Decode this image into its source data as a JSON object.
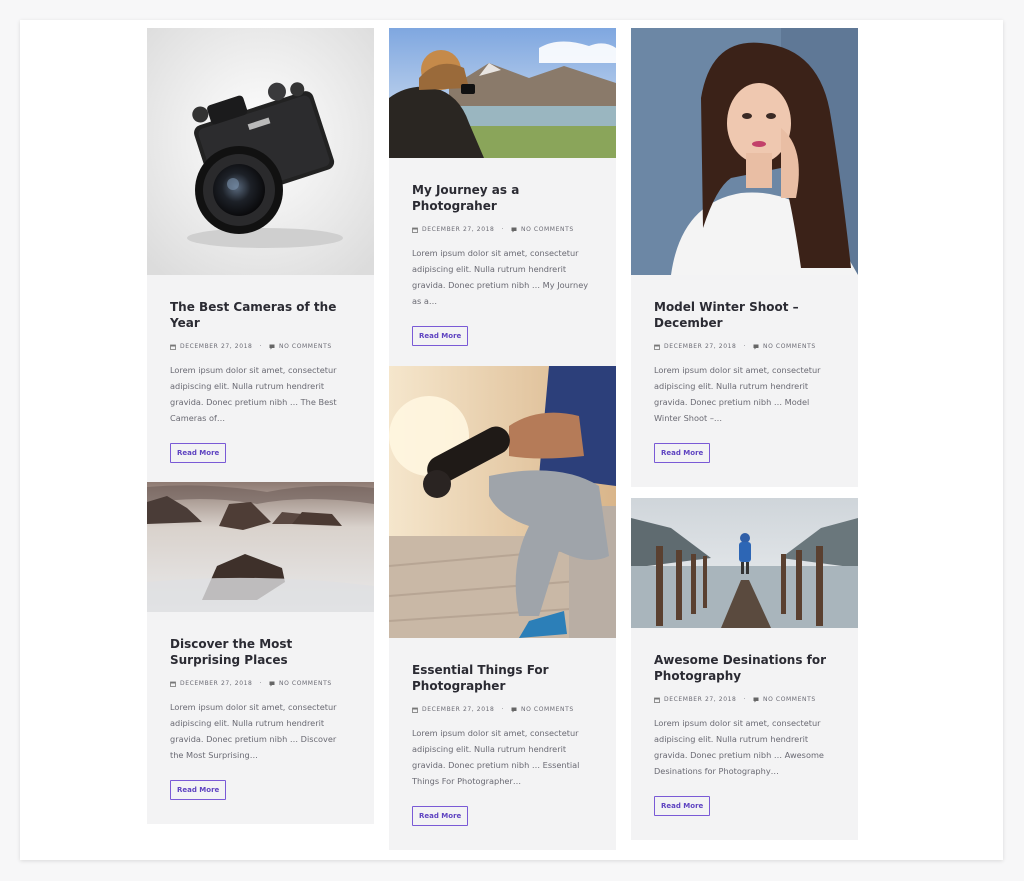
{
  "posts": [
    {
      "title": "The Best Cameras of the Year",
      "date": "DECEMBER 27, 2018",
      "comments": "NO COMMENTS",
      "excerpt": "Lorem ipsum dolor sit amet, consectetur adipiscing elit. Nulla rutrum hendrerit gravida. Donec pretium nibh … The Best Cameras of…",
      "button": "Read More",
      "image": "camera"
    },
    {
      "title": "My Journey as a Photograher",
      "date": "DECEMBER 27, 2018",
      "comments": "NO COMMENTS",
      "excerpt": "Lorem ipsum dolor sit amet, consectetur adipiscing elit. Nulla rutrum hendrerit gravida. Donec pretium nibh … My Journey as a…",
      "button": "Read More",
      "image": "photographer-lake"
    },
    {
      "title": "Model Winter Shoot – December",
      "date": "DECEMBER 27, 2018",
      "comments": "NO COMMENTS",
      "excerpt": "Lorem ipsum dolor sit amet, consectetur adipiscing elit. Nulla rutrum hendrerit gravida. Donec pretium nibh … Model Winter Shoot –…",
      "button": "Read More",
      "image": "model-portrait"
    },
    {
      "title": "Discover the Most Surprising Places",
      "date": "DECEMBER 27, 2018",
      "comments": "NO COMMENTS",
      "excerpt": "Lorem ipsum dolor sit amet, consectetur adipiscing elit. Nulla rutrum hendrerit gravida. Donec pretium nibh … Discover the Most Surprising…",
      "button": "Read More",
      "image": "rocks-sea"
    },
    {
      "title": "Essential Things For Photographer",
      "date": "DECEMBER 27, 2018",
      "comments": "NO COMMENTS",
      "excerpt": "Lorem ipsum dolor sit amet, consectetur adipiscing elit. Nulla rutrum hendrerit gravida. Donec pretium nibh … Essential Things For Photographer…",
      "button": "Read More",
      "image": "photographer-sitting"
    },
    {
      "title": "Awesome Desinations for Photography",
      "date": "DECEMBER 27, 2018",
      "comments": "NO COMMENTS",
      "excerpt": "Lorem ipsum dolor sit amet, consectetur adipiscing elit. Nulla rutrum hendrerit gravida. Donec pretium nibh … Awesome Desinations for Photography…",
      "button": "Read More",
      "image": "pier-lake"
    }
  ],
  "icons": {
    "date": "calendar-icon",
    "comments": "comment-icon"
  },
  "colors": {
    "accent": "#6b4fd0",
    "card_bg": "#f3f3f4",
    "title": "#2b2b33",
    "text": "#6a6a73"
  }
}
